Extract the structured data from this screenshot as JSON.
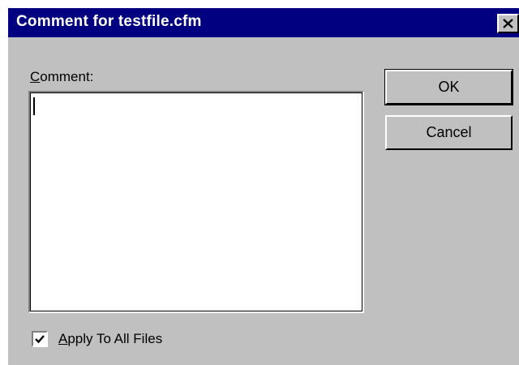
{
  "window": {
    "title": "Comment for testfile.cfm"
  },
  "form": {
    "comment_label_mnemonic": "C",
    "comment_label_rest": "omment:",
    "comment_value": ""
  },
  "buttons": {
    "ok_label": "OK",
    "cancel_label": "Cancel"
  },
  "options": {
    "apply_all_mnemonic": "A",
    "apply_all_rest": "pply To All Files",
    "apply_all_checked": true
  },
  "icons": {
    "close": "close-icon",
    "checkmark": "checkmark-icon"
  },
  "colors": {
    "titlebar": "#000080",
    "face": "#c0c0c0"
  }
}
